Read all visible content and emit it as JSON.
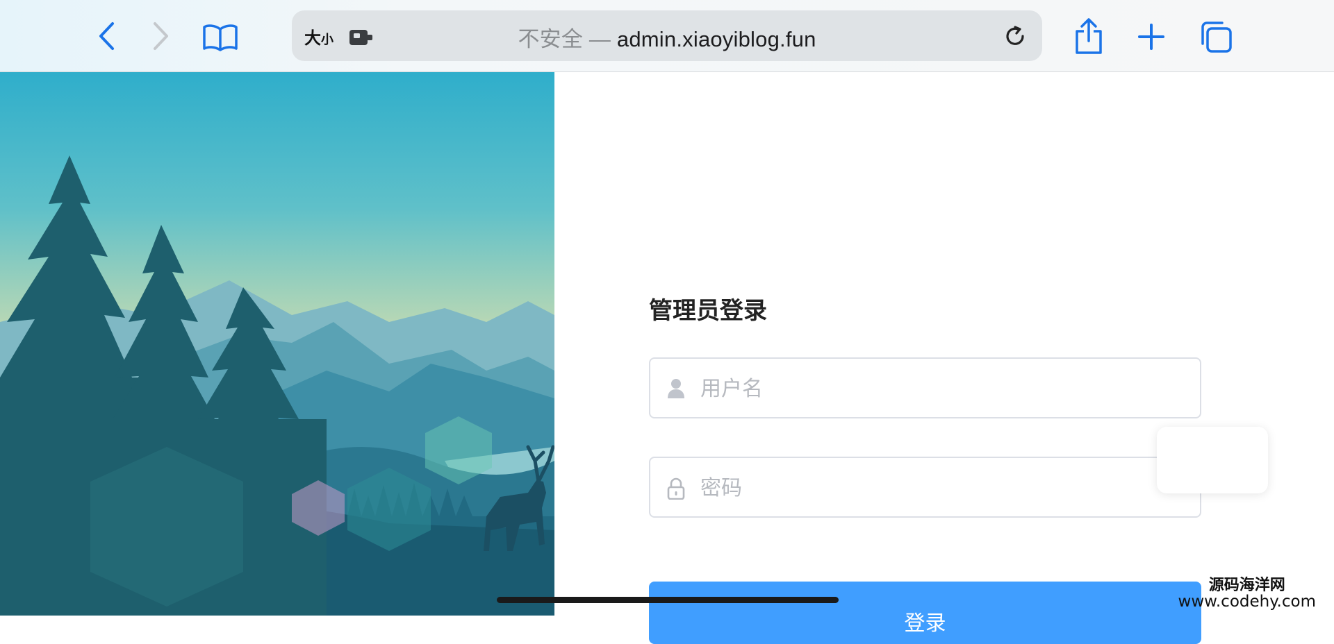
{
  "browser": {
    "text_size_large": "大",
    "text_size_small": "小",
    "url_insecure": "不安全 — ",
    "url_host": "admin.xiaoyiblog.fun",
    "icons": [
      "back-icon",
      "forward-icon",
      "bookmarks-icon",
      "extension-icon",
      "reload-icon",
      "share-icon",
      "new-tab-icon",
      "tabs-icon"
    ]
  },
  "login": {
    "title": "管理员登录",
    "username_placeholder": "用户名",
    "password_placeholder": "密码",
    "submit_label": "登录",
    "accent_color": "#409eff"
  },
  "watermark": {
    "line1": "源码海洋网",
    "line2": "www.codehy.com"
  }
}
